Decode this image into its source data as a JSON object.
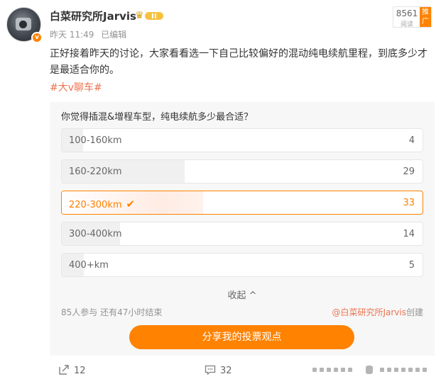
{
  "author": {
    "name": "白菜研究所Jarvis",
    "verified_mark": "v"
  },
  "post": {
    "time": "昨天 11:49",
    "edited": "已编辑",
    "text": "正好接着昨天的讨论，大家看看选一下自己比较偏好的混动纯电续航里程，到底多少才是最适合你的。",
    "hashtag": "#大v聊车#"
  },
  "views": {
    "count": "8561",
    "label": "阅读",
    "promo": "推广"
  },
  "poll": {
    "question": "你觉得插混&增程车型，纯电续航多少最合适？",
    "options": [
      {
        "label": "100-160km",
        "count": "4",
        "ratio": 0.05,
        "selected": false
      },
      {
        "label": "160-220km",
        "count": "29",
        "ratio": 0.34,
        "selected": false
      },
      {
        "label": "220-300km",
        "count": "33",
        "ratio": 0.39,
        "selected": true
      },
      {
        "label": "300-400km",
        "count": "14",
        "ratio": 0.16,
        "selected": false
      },
      {
        "label": "400+km",
        "count": "5",
        "ratio": 0.06,
        "selected": false
      }
    ],
    "collapse_label": "收起",
    "participants": "85人参与 还有47小时结束",
    "creator_link": "@白菜研究所Jarvis",
    "creator_suffix": "创建",
    "share_button": "分享我的投票观点"
  },
  "actions": {
    "forward_count": "12",
    "comment_count": "32",
    "like_text": ""
  },
  "colors": {
    "accent": "#ff8200",
    "link": "#eb7350",
    "muted": "#939393"
  },
  "icons": {
    "forward": "forward-icon",
    "comment": "comment-icon",
    "check": "check-icon",
    "collapse": "chevron-up-icon"
  }
}
